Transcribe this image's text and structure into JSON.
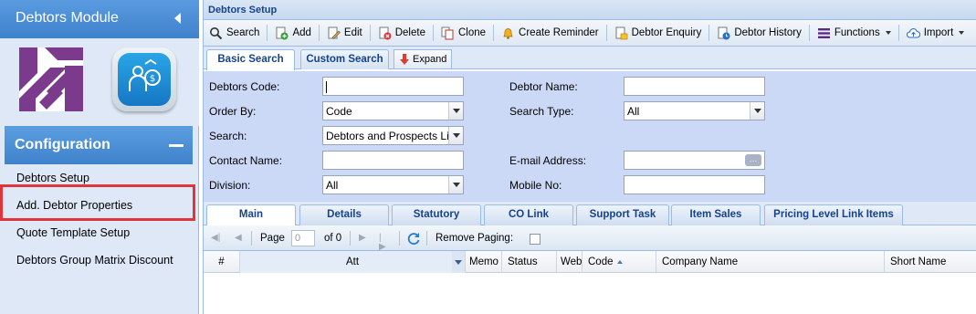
{
  "left_panel": {
    "title": "Debtors Module",
    "config_section": {
      "title": "Configuration",
      "items": [
        {
          "label": "Debtors Setup"
        },
        {
          "label": "Add. Debtor Properties"
        },
        {
          "label": "Quote Template Setup"
        },
        {
          "label": "Debtors Group Matrix Discount"
        }
      ]
    }
  },
  "panel": {
    "title": "Debtors Setup"
  },
  "toolbar": {
    "search": "Search",
    "add": "Add",
    "edit": "Edit",
    "delete": "Delete",
    "clone": "Clone",
    "create_reminder": "Create Reminder",
    "debtor_enquiry": "Debtor Enquiry",
    "debtor_history": "Debtor History",
    "functions": "Functions",
    "import": "Import"
  },
  "search_tabs": {
    "basic": "Basic Search",
    "custom": "Custom Search",
    "expand": "Expand"
  },
  "form": {
    "debtors_code_label": "Debtors Code:",
    "debtors_code_value": "",
    "debtor_name_label": "Debtor Name:",
    "debtor_name_value": "",
    "order_by_label": "Order By:",
    "order_by_value": "Code",
    "search_type_label": "Search Type:",
    "search_type_value": "All",
    "search_label": "Search:",
    "search_value": "Debtors and Prospects Li",
    "contact_name_label": "Contact Name:",
    "contact_name_value": "",
    "email_label": "E-mail Address:",
    "email_value": "",
    "ellipsis": "…",
    "division_label": "Division:",
    "division_value": "All",
    "mobile_label": "Mobile No:",
    "mobile_value": ""
  },
  "main_tabs": [
    "Main",
    "Details",
    "Statutory",
    "CO Link",
    "Support Task",
    "Item Sales",
    "Pricing Level Link Items"
  ],
  "paging": {
    "page_label": "Page",
    "page_value": "0",
    "of_label": "of 0",
    "remove_paging_label": "Remove Paging:",
    "remove_paging_checked": false
  },
  "grid": {
    "columns": [
      "#",
      "Att",
      "Memo",
      "Status",
      "Webs",
      "Code",
      "Company Name",
      "Short Name"
    ]
  },
  "colors": {
    "header_blue": "#4a8fd6",
    "panel_bg": "#dfe8f6",
    "form_bg": "#ccd9f6",
    "title_text": "#15428b",
    "highlight_red": "#e0353a"
  }
}
